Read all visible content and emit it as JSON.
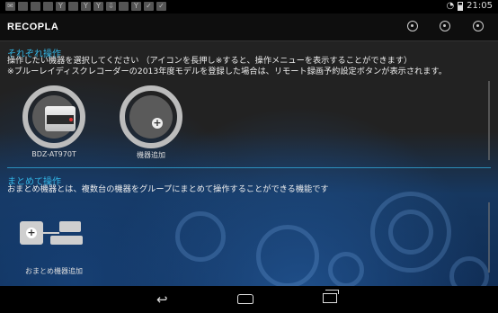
{
  "status_bar": {
    "left_icons": [
      "notif-icon-1",
      "notif-icon-2",
      "notif-icon-3",
      "notif-icon-4",
      "notif-icon-5",
      "notif-icon-6",
      "notif-icon-7",
      "notif-icon-8",
      "notif-icon-9",
      "notif-icon-10",
      "notif-icon-11",
      "notif-icon-12",
      "notif-icon-13"
    ],
    "time": "21:05"
  },
  "app_bar": {
    "title": "RECOPLA",
    "actions": [
      "settings-icon",
      "refresh-icon",
      "menu-icon"
    ]
  },
  "section_individual": {
    "heading": "それぞれ操作",
    "desc_line1": "操作したい機器を選択してください （アイコンを長押し※すると、操作メニューを表示することができます）",
    "desc_line2": "※ブルーレイディスクレコーダーの2013年度モデルを登録した場合は、リモート録画予約設定ボタンが表示されます。",
    "devices": [
      {
        "label": "BDZ-AT970T",
        "icon": "recorder-icon"
      },
      {
        "label": "機器追加",
        "icon": "add-icon"
      }
    ]
  },
  "section_group": {
    "heading": "まとめて操作",
    "desc": "おまとめ機器とは、複数台の機器をグループにまとめて操作することができる機能です",
    "add_label": "おまとめ機器追加"
  },
  "nav_bar": {
    "buttons": [
      "back-icon",
      "home-icon",
      "recents-icon"
    ]
  },
  "colors": {
    "accent": "#33b5e5",
    "background_top": "#222222",
    "background_bottom": "#0e2a52"
  }
}
